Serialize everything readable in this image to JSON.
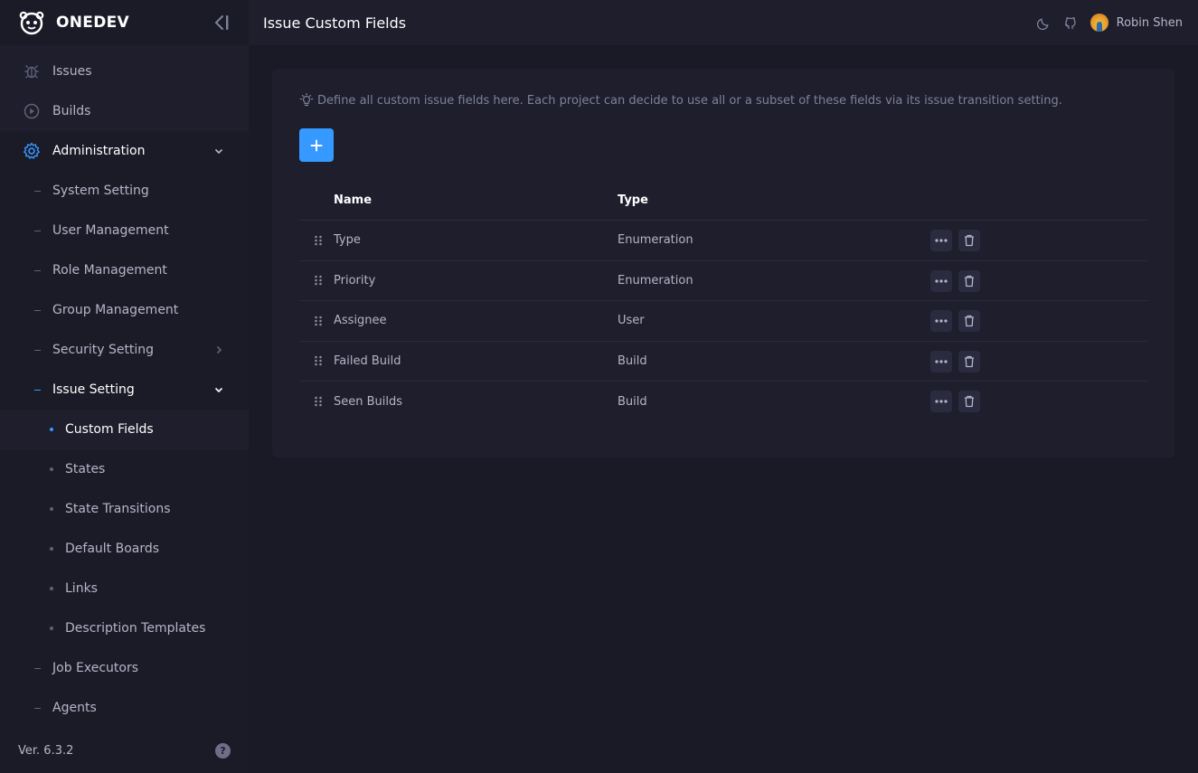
{
  "app": {
    "name": "ONEDEV",
    "version": "Ver. 6.3.2"
  },
  "header": {
    "title": "Issue Custom Fields",
    "user_name": "Robin Shen"
  },
  "sidebar": {
    "items": [
      {
        "label": "Issues",
        "icon": "bug-icon"
      },
      {
        "label": "Builds",
        "icon": "play-circle-icon"
      },
      {
        "label": "Administration",
        "icon": "gear-icon",
        "expanded": true
      }
    ],
    "admin_items": [
      {
        "label": "System Setting"
      },
      {
        "label": "User Management"
      },
      {
        "label": "Role Management"
      },
      {
        "label": "Group Management"
      },
      {
        "label": "Security Setting",
        "has_children": true
      },
      {
        "label": "Issue Setting",
        "expanded": true
      },
      {
        "label": "Job Executors"
      },
      {
        "label": "Agents"
      }
    ],
    "issue_setting_items": [
      {
        "label": "Custom Fields",
        "active": true
      },
      {
        "label": "States"
      },
      {
        "label": "State Transitions"
      },
      {
        "label": "Default Boards"
      },
      {
        "label": "Links"
      },
      {
        "label": "Description Templates"
      }
    ]
  },
  "main": {
    "tip": "Define all custom issue fields here. Each project can decide to use all or a subset of these fields via its issue transition setting.",
    "add_label": "+",
    "table": {
      "headers": {
        "name": "Name",
        "type": "Type"
      },
      "rows": [
        {
          "name": "Type",
          "type": "Enumeration"
        },
        {
          "name": "Priority",
          "type": "Enumeration"
        },
        {
          "name": "Assignee",
          "type": "User"
        },
        {
          "name": "Failed Build",
          "type": "Build"
        },
        {
          "name": "Seen Builds",
          "type": "Build"
        }
      ]
    }
  },
  "colors": {
    "accent": "#3699ff",
    "background": "#1a1a27",
    "panel": "#1e1e2d"
  }
}
